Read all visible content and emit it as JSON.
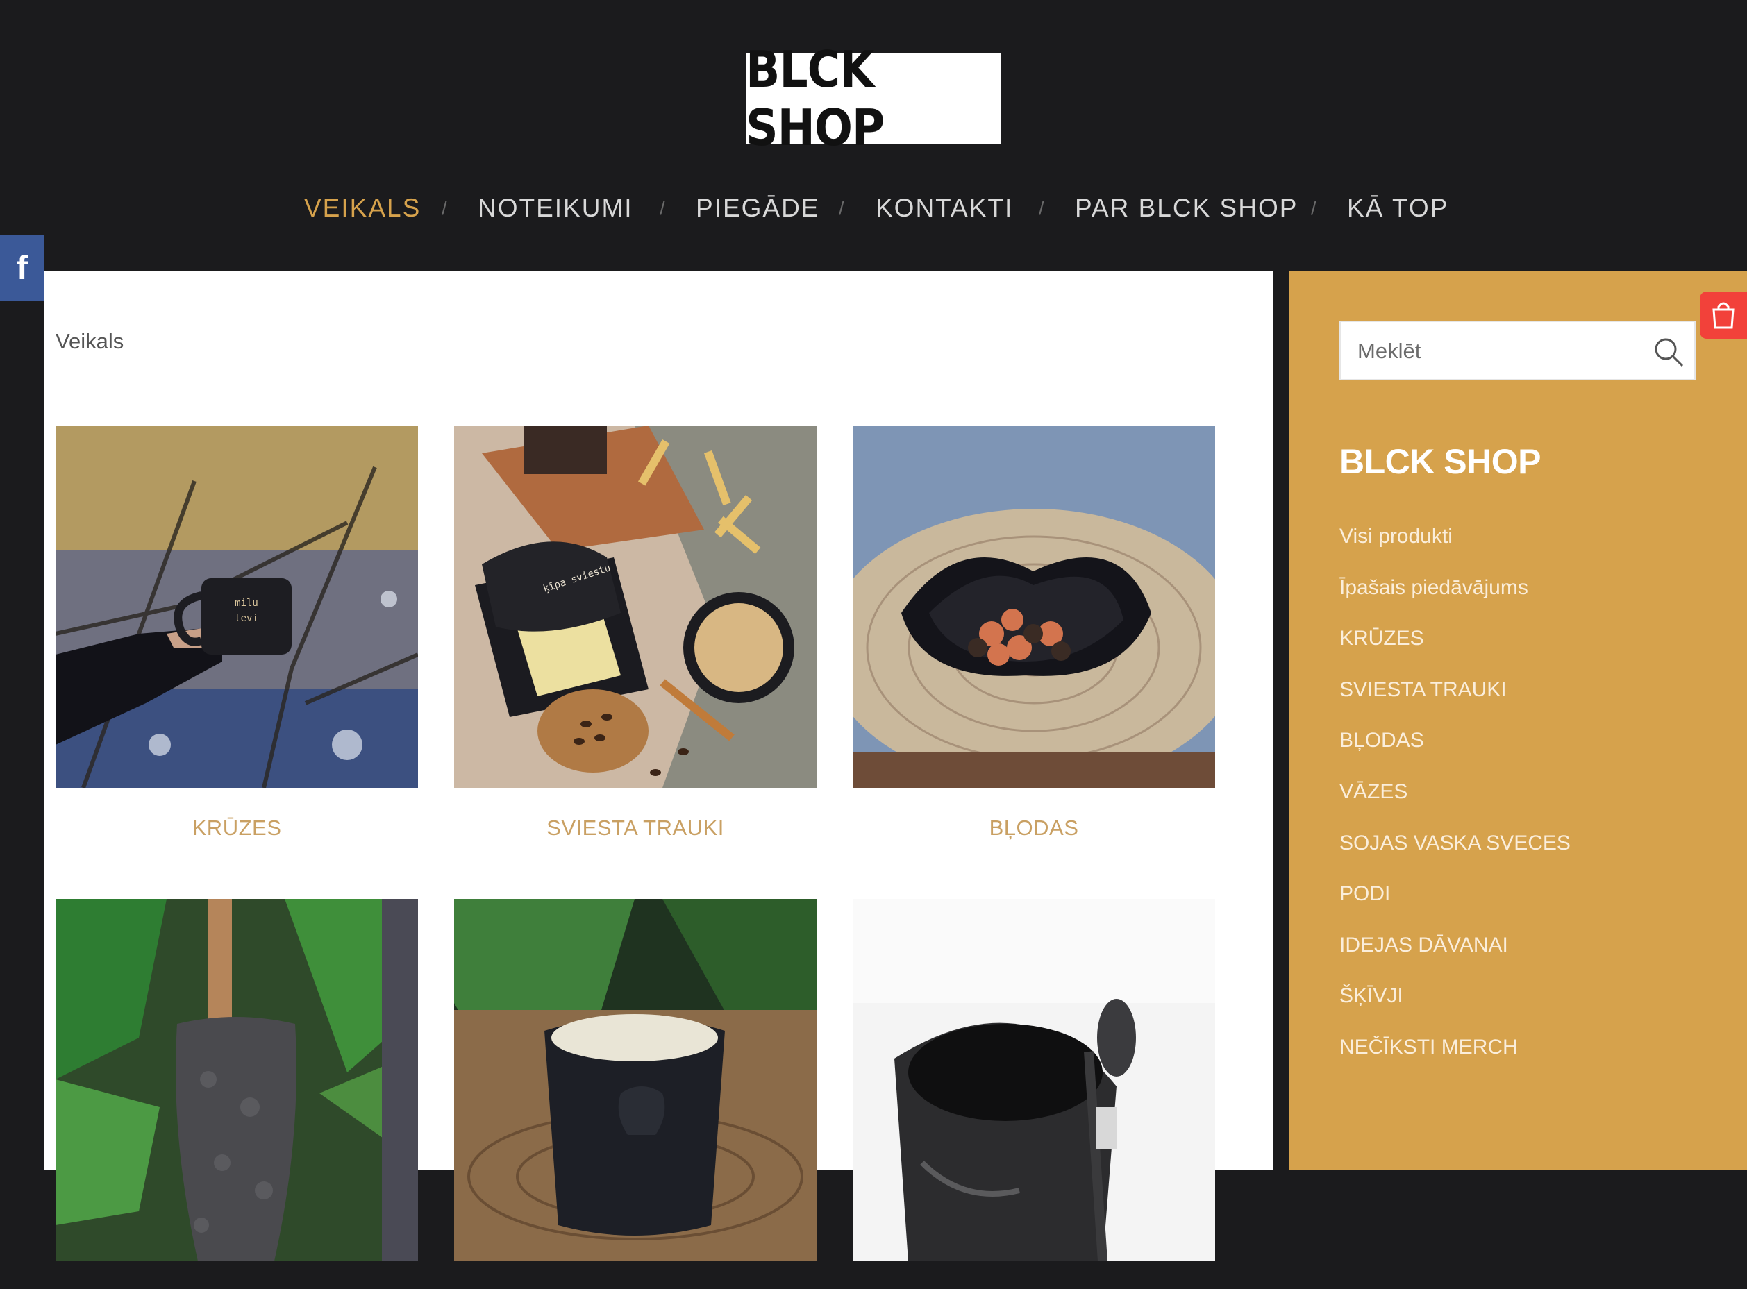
{
  "logo": "BLCK SHOP",
  "nav": [
    "VEIKALS",
    "NOTEIKUMI",
    "PIEGĀDE",
    "KONTAKTI",
    "PAR BLCK SHOP",
    "KĀ TOP"
  ],
  "nav_separator": "/",
  "active_nav": "VEIKALS",
  "social": {
    "facebook": "f"
  },
  "breadcrumb": "Veikals",
  "products": [
    {
      "label": "KRŪZES"
    },
    {
      "label": "SVIESTA TRAUKI"
    },
    {
      "label": "BĻODAS"
    },
    {
      "label": ""
    },
    {
      "label": ""
    },
    {
      "label": ""
    }
  ],
  "sidebar": {
    "search_placeholder": "Meklēt",
    "title": "BLCK SHOP",
    "links": [
      "Visi produkti",
      "Īpašais piedāvājums",
      "KRŪZES",
      "SVIESTA TRAUKI",
      "BĻODAS",
      "VĀZES",
      "SOJAS VASKA SVECES",
      "PODI",
      "IDEJAS DĀVANAI",
      "ŠĶĪVJI",
      "NEČĪKSTI MERCH"
    ]
  },
  "colors": {
    "accent": "#d6a24c",
    "header_bg": "#1b1b1d",
    "facebook": "#3b5998",
    "cart": "#f2413a"
  },
  "icons": [
    "facebook-icon",
    "search-icon",
    "shopping-bag-icon"
  ]
}
